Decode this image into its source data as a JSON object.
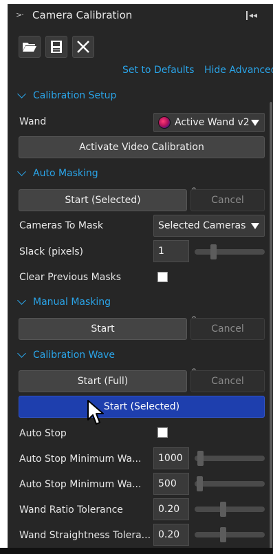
{
  "title": "Camera Calibration",
  "toolbar": {
    "open_icon": "folder-open-icon",
    "save_icon": "save-icon",
    "close_icon": "close-icon"
  },
  "links": {
    "set_defaults": "Set to Defaults",
    "hide_advanced": "Hide Advanced"
  },
  "calibration_setup": {
    "header": "Calibration Setup",
    "wand_label": "Wand",
    "wand_value": "Active Wand v2",
    "activate_button": "Activate Video Calibration"
  },
  "auto_masking": {
    "header": "Auto Masking",
    "start_button": "Start (Selected)",
    "cancel_button": "Cancel",
    "cameras_label": "Cameras To Mask",
    "cameras_value": "Selected Cameras",
    "slack_label": "Slack (pixels)",
    "slack_value": "1",
    "clear_label": "Clear Previous Masks",
    "clear_checked": false
  },
  "manual_masking": {
    "header": "Manual Masking",
    "start_button": "Start",
    "cancel_button": "Cancel"
  },
  "calibration_wave": {
    "header": "Calibration Wave",
    "start_full_button": "Start (Full)",
    "cancel_button": "Cancel",
    "start_selected_button": "Start (Selected)",
    "auto_stop_label": "Auto Stop",
    "auto_stop_checked": false,
    "min_wa_1_label": "Auto Stop Minimum Wa...",
    "min_wa_1_value": "1000",
    "min_wa_2_label": "Auto Stop Minimum Wa...",
    "min_wa_2_value": "500",
    "ratio_label": "Wand Ratio Tolerance",
    "ratio_value": "0.20",
    "straight_label": "Wand Straightness Tolera...",
    "straight_value": "0.20"
  },
  "colors": {
    "panel_bg": "#262626",
    "accent": "#2aa4e8",
    "primary_button": "#1e3fae"
  }
}
